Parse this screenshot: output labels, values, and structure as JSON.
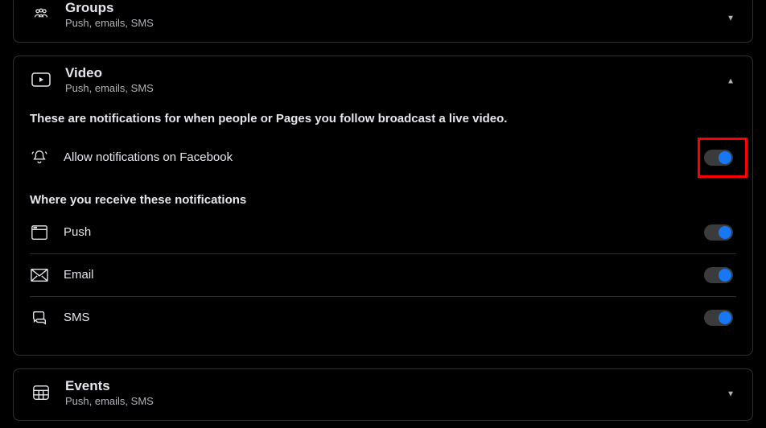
{
  "sections": {
    "groups": {
      "title": "Groups",
      "subtitle": "Push, emails, SMS"
    },
    "video": {
      "title": "Video",
      "subtitle": "Push, emails, SMS",
      "description": "These are notifications for when people or Pages you follow broadcast a live video.",
      "allow_label": "Allow notifications on Facebook",
      "where_heading": "Where you receive these notifications",
      "channels": {
        "push": "Push",
        "email": "Email",
        "sms": "SMS"
      }
    },
    "events": {
      "title": "Events",
      "subtitle": "Push, emails, SMS"
    }
  }
}
